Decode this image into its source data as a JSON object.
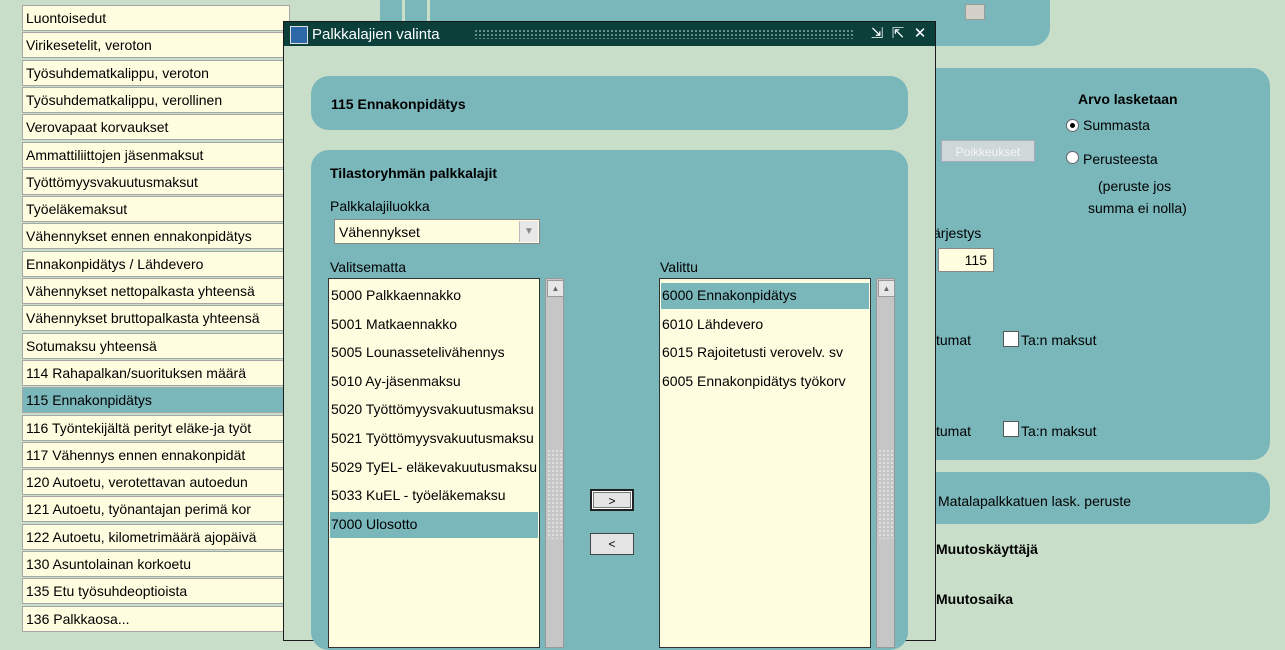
{
  "background_list": [
    "Luontoisedut",
    "Virikesetelit, veroton",
    "Työsuhdematkalippu, veroton",
    "Työsuhdematkalippu, verollinen",
    "Verovapaat korvaukset",
    "Ammattiliittojen jäsenmaksut",
    "Työttömyysvakuutusmaksut",
    "Työeläkemaksut",
    "Vähennykset ennen ennakonpidätys",
    "Ennakonpidätys / Lähdevero",
    "Vähennykset nettopalkasta yhteensä",
    "Vähennykset bruttopalkasta yhteensä",
    "Sotumaksu yhteensä",
    "114 Rahapalkan/suorituksen määrä",
    "115 Ennakonpidätys",
    "116 Työntekijältä perityt eläke-ja työt",
    "117 Vähennys ennen ennakonpidät",
    "120 Autoetu, verotettavan autoedun",
    "121 Autoetu, työnantajan perimä kor",
    "122 Autoetu, kilometrimäärä ajopäivä",
    "130 Asuntolainan korkoetu",
    "135 Etu työsuhdeoptioista",
    "136 Palkkaosa..."
  ],
  "right_panel": {
    "arvo_title": "Arvo lasketaan",
    "radio_summasta": "Summasta",
    "radio_perusteesta": "Perusteesta",
    "peruste_note_1": "(peruste jos",
    "peruste_note_2": "summa ei nolla)",
    "poikkeukset_button": "Poikkeukset",
    "jarjestys_label": "Järjestys",
    "jarjestys_value": "115",
    "tumat_1": "tumat",
    "tan_maksut_1": "Ta:n maksut",
    "tumat_2": "tumat",
    "tan_maksut_2": "Ta:n maksut",
    "matalapalkkatuen": "Matalapalkkatuen lask. peruste",
    "muutoskayttaja": "Muutoskäyttäjä",
    "muutosaika": "Muutosaika"
  },
  "dialog": {
    "title": "Palkkalajien valinta",
    "heading": "115 Ennakonpidätys",
    "group_title": "Tilastoryhmän palkkalajit",
    "class_label": "Palkkalajiluokka",
    "class_value": "Vähennykset",
    "unselected_label": "Valitsematta",
    "selected_label": "Valittu",
    "unselected_items": [
      "5000 Palkkaennakko",
      "5001 Matkaennakko",
      "5005 Lounassetelivähennys",
      "5010 Ay-jäsenmaksu",
      "5020 Työttömyysvakuutusmaksu",
      "5021 Työttömyysvakuutusmaksu",
      "5029 TyEL- eläkevakuutusmaksu",
      "5033 KuEL - työeläkemaksu",
      "7000 Ulosotto"
    ],
    "selected_items": [
      "6000 Ennakonpidätys",
      "6010 Lähdevero",
      "6015 Rajoitetusti verovelv. sv",
      "6005 Ennakonpidätys työkorv"
    ],
    "add_button": ">",
    "remove_button": "<"
  },
  "colors": {
    "panel": "#7ab7bb",
    "background": "#c9dec9",
    "field": "#fffde0",
    "titlebar": "#0a3f3a"
  }
}
